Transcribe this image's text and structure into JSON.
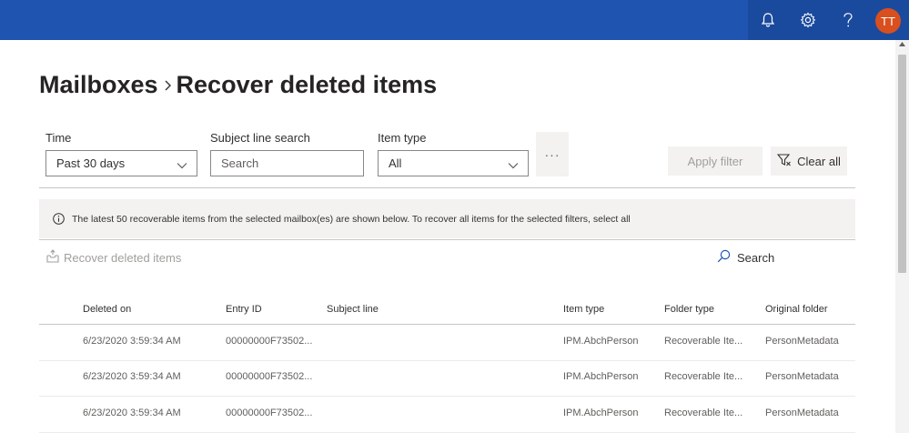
{
  "header": {
    "user_initials": "TT",
    "icons": [
      "bell-icon",
      "gear-icon",
      "help-icon"
    ]
  },
  "page": {
    "breadcrumb_parent": "Mailboxes",
    "title": "Recover deleted items"
  },
  "filters": {
    "time_label": "Time",
    "time_value": "Past 30 days",
    "subject_label": "Subject line search",
    "subject_placeholder": "Search",
    "item_type_label": "Item type",
    "item_type_value": "All",
    "more_label": "···",
    "apply_label": "Apply filter",
    "clear_label": "Clear all"
  },
  "info": {
    "message": "The latest 50 recoverable items from the selected mailbox(es) are shown below. To recover all items for the selected filters, select all"
  },
  "commands": {
    "recover_label": "Recover deleted items",
    "search_label": "Search"
  },
  "table": {
    "columns": [
      "Deleted on",
      "Entry ID",
      "Subject line",
      "Item type",
      "Folder type",
      "Original folder"
    ],
    "rows": [
      [
        "6/23/2020 3:59:34 AM",
        "00000000F73502...",
        "",
        "IPM.AbchPerson",
        "Recoverable Ite...",
        "PersonMetadata"
      ],
      [
        "6/23/2020 3:59:34 AM",
        "00000000F73502...",
        "",
        "IPM.AbchPerson",
        "Recoverable Ite...",
        "PersonMetadata"
      ],
      [
        "6/23/2020 3:59:34 AM",
        "00000000F73502...",
        "",
        "IPM.AbchPerson",
        "Recoverable Ite...",
        "PersonMetadata"
      ]
    ]
  },
  "colors": {
    "header_bg": "#1f55b0",
    "avatar_bg": "#d94f1e"
  }
}
